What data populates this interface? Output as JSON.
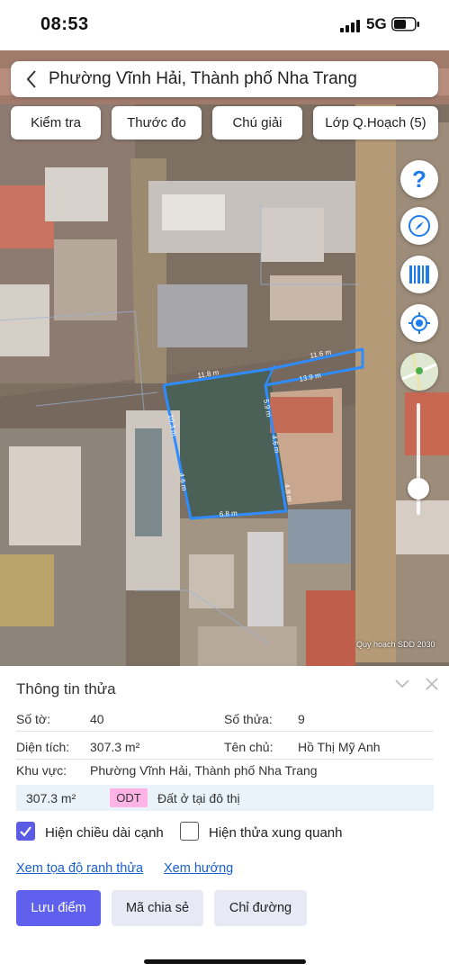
{
  "status": {
    "time": "08:53",
    "network": "5G"
  },
  "map": {
    "header_title": "Phường Vĩnh Hải, Thành phố Nha Trang",
    "toolbar": [
      {
        "label": "Kiểm tra"
      },
      {
        "label": "Thước đo"
      },
      {
        "label": "Chú giải"
      },
      {
        "label": "Lớp Q.Hoạch (5)"
      }
    ],
    "side_buttons": [
      "help-icon",
      "compass-icon",
      "barcode-icon",
      "locate-icon",
      "map-layer-icon"
    ],
    "edge_labels": [
      "11.6 m",
      "11.8 m",
      "13.9 m",
      "5.9 m",
      "4.6 m",
      "10.3 m",
      "4.8 m",
      "4.6 m",
      "6.8 m"
    ],
    "watermark": "Quy hoạch SDD 2030",
    "parcel_color": "#2e8cff"
  },
  "panel": {
    "title": "Thông tin thửa",
    "sheet_label": "Số tờ:",
    "sheet_value": "40",
    "plot_label": "Số thửa:",
    "plot_value": "9",
    "area_label": "Diện tích:",
    "area_value": "307.3 m²",
    "owner_label": "Tên chủ:",
    "owner_value": "Hồ Thị Mỹ Anh",
    "region_label": "Khu vực:",
    "region_value": "Phường Vĩnh Hải, Thành phố Nha Trang",
    "land_area": "307.3 m²",
    "land_code": "ODT",
    "land_desc": "Đất ở tại đô thị",
    "check_edges": "Hiện chiều dài cạnh",
    "check_edges_checked": true,
    "check_neighbors": "Hiện thửa xung quanh",
    "check_neighbors_checked": false,
    "link_coords": "Xem tọa độ ranh thửa",
    "link_direction": "Xem hướng",
    "btn_save": "Lưu điểm",
    "btn_share": "Mã chia sẻ",
    "btn_route": "Chỉ đường",
    "accent": "#6060ee"
  }
}
